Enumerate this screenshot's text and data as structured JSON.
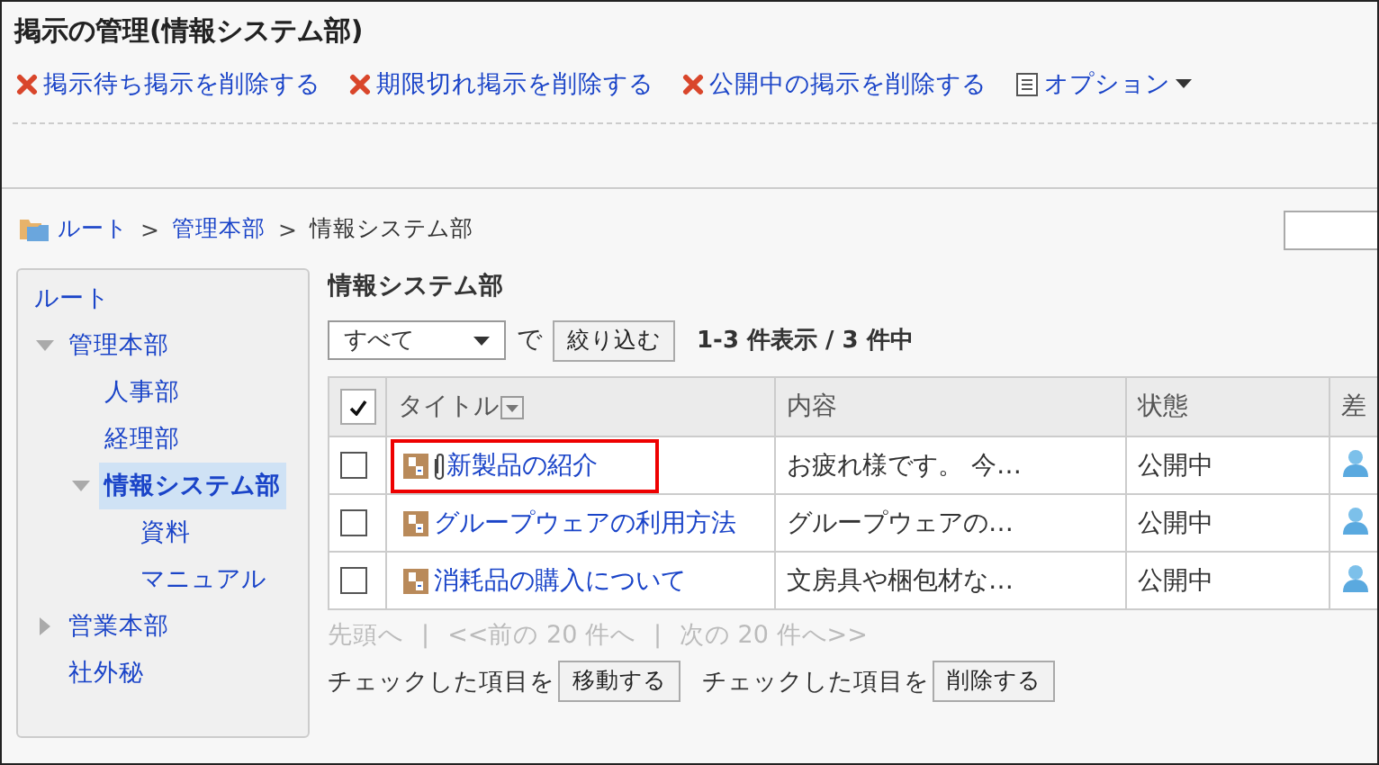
{
  "page_title": "掲示の管理(情報システム部)",
  "toolbar": [
    {
      "kind": "delete",
      "label": "掲示待ち掲示を削除する"
    },
    {
      "kind": "delete",
      "label": "期限切れ掲示を削除する"
    },
    {
      "kind": "delete",
      "label": "公開中の掲示を削除する"
    },
    {
      "kind": "menu",
      "label": "オプション"
    }
  ],
  "breadcrumb": [
    {
      "label": "ルート",
      "link": true
    },
    {
      "label": "管理本部",
      "link": true
    },
    {
      "label": "情報システム部",
      "link": false
    }
  ],
  "breadcrumb_separator": ">",
  "sidebar": {
    "items": [
      {
        "label": "ルート",
        "selected": false,
        "children": [
          {
            "label": "管理本部",
            "expanded": true,
            "selected": false,
            "children": [
              {
                "label": "人事部",
                "selected": false
              },
              {
                "label": "経理部",
                "selected": false
              },
              {
                "label": "情報システム部",
                "expanded": true,
                "selected": true,
                "children": [
                  {
                    "label": "資料",
                    "selected": false
                  },
                  {
                    "label": "マニュアル",
                    "selected": false
                  }
                ]
              }
            ]
          },
          {
            "label": "営業本部",
            "expanded": false,
            "selected": false
          },
          {
            "label": "社外秘",
            "selected": false
          }
        ]
      }
    ]
  },
  "folder_title": "情報システム部",
  "filter": {
    "value": "すべて",
    "connector": "で",
    "button": "絞り込む",
    "count": "1-3 件表示 / 3 件中"
  },
  "table": {
    "header_checked": true,
    "columns": [
      "タイトル",
      "内容",
      "状態",
      "差"
    ],
    "rows": [
      {
        "checked": false,
        "attachment": true,
        "highlighted": true,
        "title": "新製品の紹介",
        "content": "お疲れ様です。 今…",
        "status": "公開中"
      },
      {
        "checked": false,
        "attachment": false,
        "highlighted": false,
        "title": "グループウェアの利用方法",
        "content": "グループウェアの…",
        "status": "公開中"
      },
      {
        "checked": false,
        "attachment": false,
        "highlighted": false,
        "title": "消耗品の購入について",
        "content": "文房具や梱包材な…",
        "status": "公開中"
      }
    ]
  },
  "pager": [
    "先頭へ",
    "|",
    "<<前の 20 件へ",
    "|",
    "次の 20 件へ>>"
  ],
  "actions": [
    {
      "label": "チェックした項目を",
      "button": "移動する"
    },
    {
      "label": "チェックした項目を",
      "button": "削除する"
    }
  ]
}
